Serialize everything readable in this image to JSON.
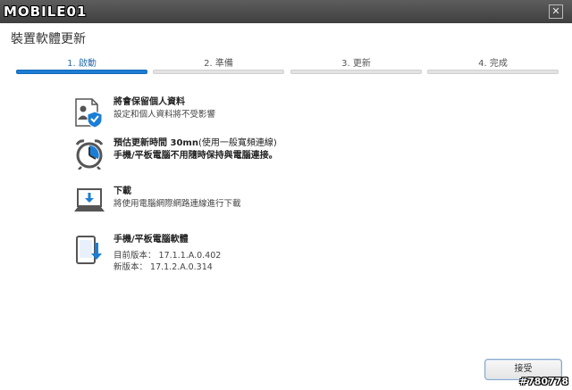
{
  "window": {
    "logo": "MOBILE01",
    "close_glyph": "✕"
  },
  "dialog": {
    "title": "裝置軟體更新"
  },
  "steps": [
    {
      "label": "1. 啟動",
      "active": true
    },
    {
      "label": "2. 準備",
      "active": false
    },
    {
      "label": "3. 更新",
      "active": false
    },
    {
      "label": "4. 完成",
      "active": false
    }
  ],
  "items": [
    {
      "icon": "user-shield-icon",
      "title": "將會保留個人資料",
      "lines": [
        "設定和個人資料將不受影響"
      ]
    },
    {
      "icon": "alarm-clock-icon",
      "title_prefix": "預估更新時間 30mn",
      "title_suffix": "(使用一般寬頻連線)",
      "lines": [
        "手機/平板電腦不用隨時保持與電腦連接。"
      ]
    },
    {
      "icon": "laptop-download-icon",
      "title": "下載",
      "lines": [
        "將使用電腦網際網路連線進行下載"
      ]
    },
    {
      "icon": "tablet-download-icon",
      "title": "手機/平板電腦軟體",
      "lines": [
        "目前版本： 17.1.1.A.0.402",
        "新版本： 17.1.2.A.0.314"
      ]
    }
  ],
  "buttons": {
    "accept": "接受"
  },
  "watermark": "#780778",
  "colors": {
    "accent": "#1b7ed6",
    "titlebar": "#4a4a4a"
  }
}
